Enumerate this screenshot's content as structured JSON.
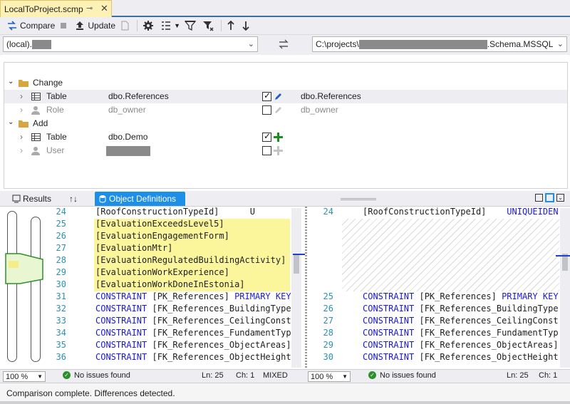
{
  "document_tab": {
    "title": "LocalToProject.scmp",
    "pin_icon": "pin-icon",
    "close_icon": "close-icon"
  },
  "toolbar": {
    "compare_label": "Compare",
    "update_label": "Update",
    "icons": [
      "compare-icon",
      "stop-icon",
      "update-icon",
      "generate-script-icon",
      "settings-icon",
      "group-by-icon",
      "filter-icon",
      "filter-clear-icon",
      "up-arrow-icon",
      "down-arrow-icon"
    ]
  },
  "source": {
    "value": "(local)."
  },
  "target": {
    "prefix": "C:\\projects\\",
    "suffix": ".Schema.MSSQL"
  },
  "tree": {
    "groups": [
      {
        "label": "Change",
        "rows": [
          {
            "type": "Table",
            "source_name": "dbo.References",
            "target_name": "dbo.References",
            "checked": true,
            "action": "edit",
            "selected": true
          },
          {
            "type": "Role",
            "source_name": "db_owner",
            "target_name": "db_owner",
            "checked": false,
            "action": "edit",
            "muted": true
          }
        ]
      },
      {
        "label": "Add",
        "rows": [
          {
            "type": "Table",
            "source_name": "dbo.Demo",
            "target_name": "",
            "checked": true,
            "action": "add"
          },
          {
            "type": "User",
            "source_name": "",
            "target_name": "",
            "checked": false,
            "action": "add",
            "muted": true
          }
        ]
      }
    ]
  },
  "lower_tabs": {
    "results": "Results",
    "swap": "↑↓",
    "object_definitions": "Object Definitions"
  },
  "left_code": {
    "line_numbers": [
      "24",
      "25",
      "26",
      "27",
      "28",
      "29",
      "30",
      "31",
      "32",
      "33",
      "34",
      "35",
      "36"
    ],
    "lines": [
      "[RoofConstructionTypeId]      U",
      "[EvaluationExceedsLevel5]     ",
      "[EvaluationEngagementForm]    ",
      "[EvaluationMtr]               ",
      "[EvaluationRegulatedBuildingActivity]  ",
      "[EvaluationWorkExperience]    ",
      "[EvaluationWorkDoneInEstonia] ",
      "CONSTRAINT [PK_References] PRIMARY KEY",
      "CONSTRAINT [FK_References_BuildingTypes",
      "CONSTRAINT [FK_References_CeilingConstr",
      "CONSTRAINT [FK_References_FundamentType",
      "CONSTRAINT [FK_References_ObjectAreas]",
      "CONSTRAINT [FK_References_ObjectHeights"
    ]
  },
  "right_code": {
    "line_numbers": [
      "24",
      "25",
      "26",
      "27",
      "28",
      "29",
      "30"
    ],
    "lines": [
      "[RoofConstructionTypeId]    UNIQUEIDEN",
      "CONSTRAINT [PK_References] PRIMARY KEY",
      "CONSTRAINT [FK_References_BuildingType",
      "CONSTRAINT [FK_References_CeilingConst",
      "CONSTRAINT [FK_References_FundamentTyp",
      "CONSTRAINT [FK_References_ObjectAreas]",
      "CONSTRAINT [FK_References_ObjectHeight"
    ]
  },
  "left_status": {
    "zoom": "100 %",
    "issues": "No issues found",
    "ln": "Ln: 25",
    "ch": "Ch: 1",
    "mode": "MIXED"
  },
  "right_status": {
    "zoom": "100 %",
    "issues": "No issues found",
    "ln": "Ln: 25",
    "ch": "Ch: 1"
  },
  "status_message": "Comparison complete.  Differences detected.",
  "colors": {
    "accent": "#1e8fe6",
    "diff_highlight": "#fbf59b",
    "keyword": "#1a1ad6",
    "line_number": "#2b91af",
    "tab_gold": "#fdf1b5",
    "add_green": "#1a8f1a",
    "edit_blue": "#1c5cc4"
  }
}
